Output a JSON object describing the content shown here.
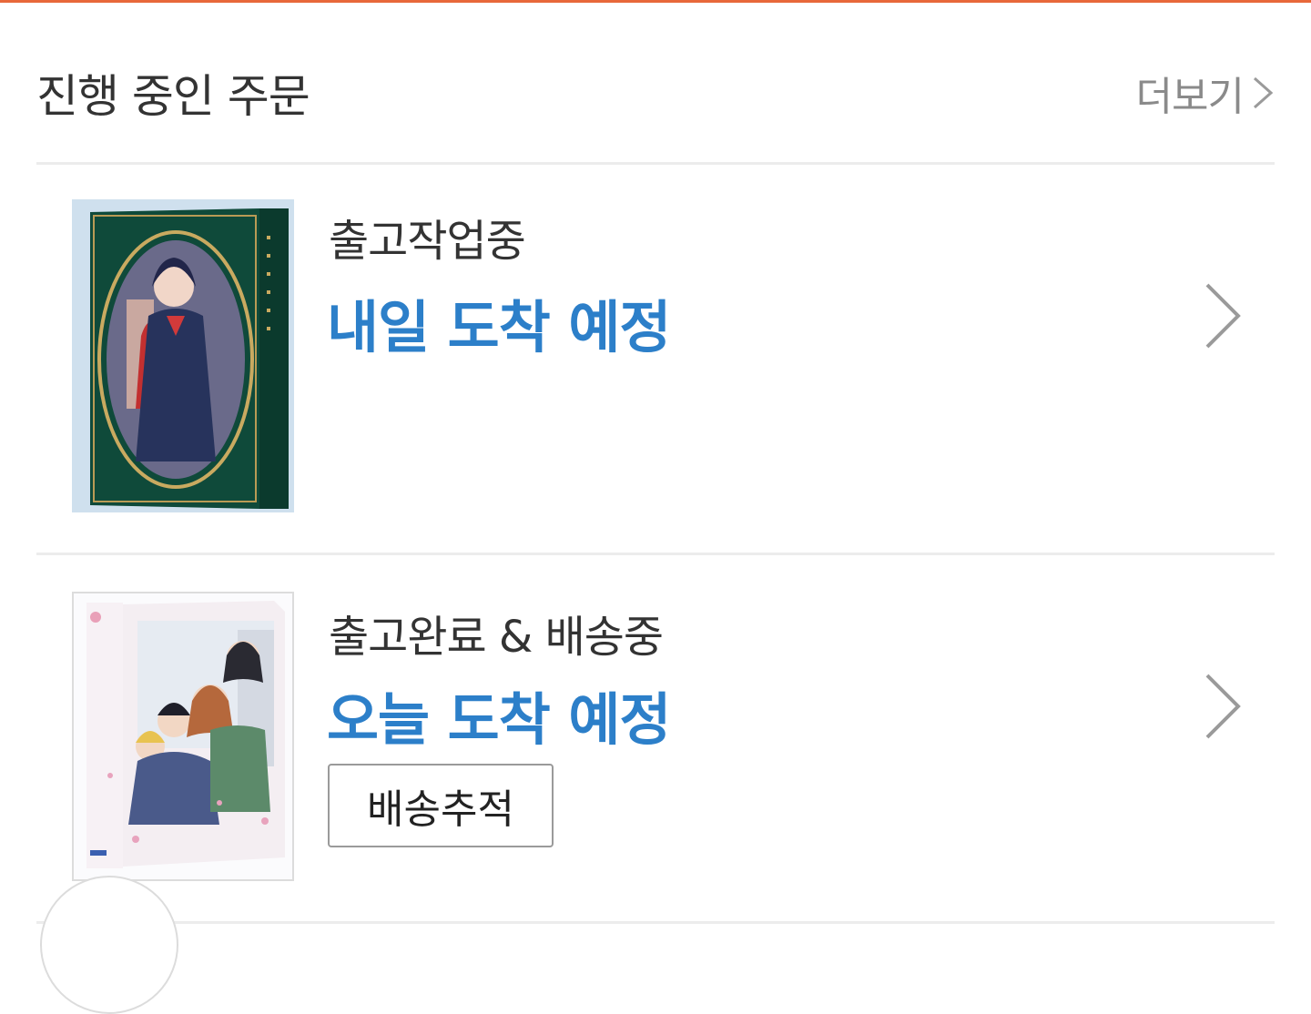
{
  "colors": {
    "accent_bar": "#e8683a",
    "eta_blue": "#2c7fc9",
    "muted_text": "#8a8a8a"
  },
  "header": {
    "title": "진행 중인 주문",
    "more_label": "더보기",
    "more_icon": "chevron-right-icon"
  },
  "orders": [
    {
      "status": "출고작업중",
      "eta": "내일 도착 예정",
      "thumbnail": "product-thumbnail-kagami-no-kojou-bluray"
    },
    {
      "status": "출고완료 & 배송중",
      "eta": "오늘 도착 예정",
      "track_button": "배송추적",
      "thumbnail": "product-thumbnail-omoi-omoware-furi-furare-bluray"
    }
  ]
}
